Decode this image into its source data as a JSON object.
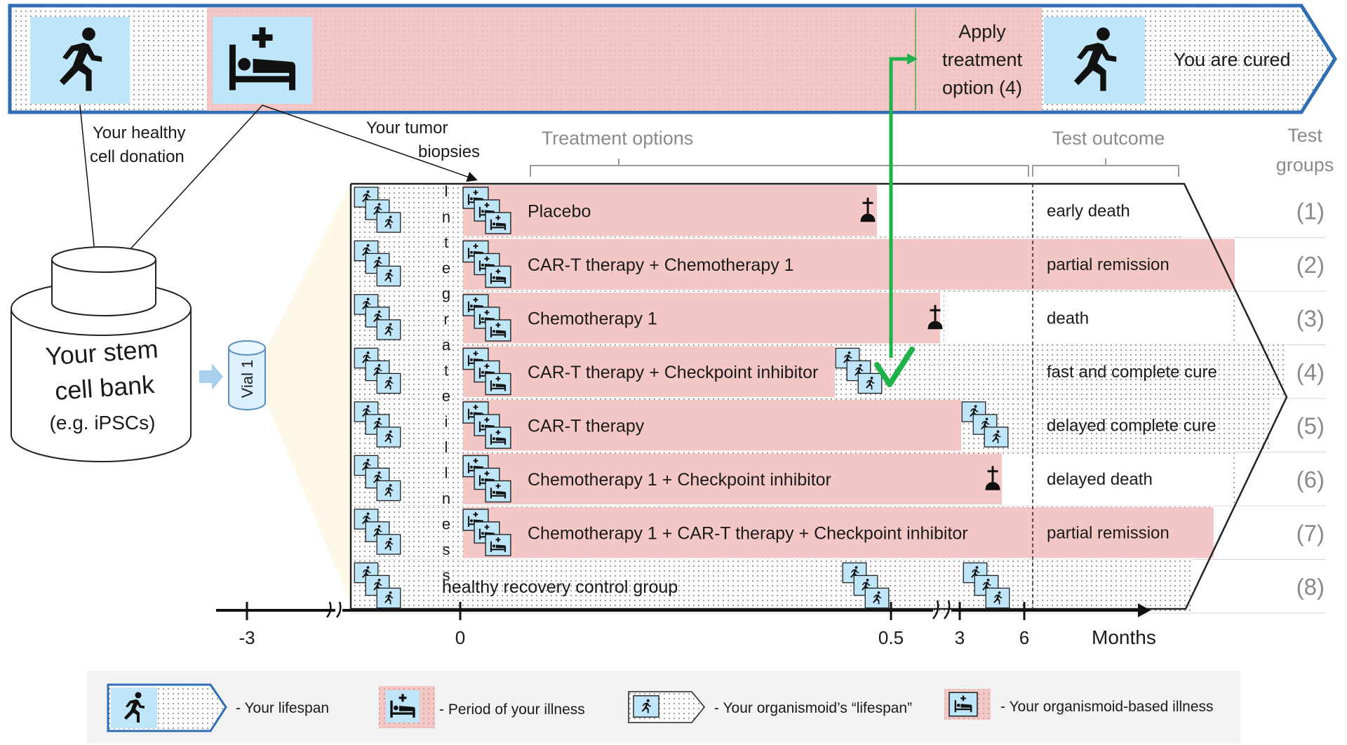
{
  "banner": {
    "apply_line1": "Apply",
    "apply_line2": "treatment",
    "apply_line3": "option (4)",
    "cured": "You are cured",
    "healthy_donation_line1": "Your healthy",
    "healthy_donation_line2": "cell donation",
    "tumor_biopsies_line1": "Your tumor",
    "tumor_biopsies_line2": "biopsies"
  },
  "stem_cell_bank": {
    "line1": "Your stem",
    "line2": "cell bank",
    "line3": "(e.g. iPSCs)",
    "vial": "Vial 1"
  },
  "headers": {
    "treatment_options": "Treatment options",
    "test_outcome": "Test outcome",
    "test_groups_line1": "Test",
    "test_groups_line2": "groups"
  },
  "integrate_letters": [
    "I",
    "n",
    "t",
    "e",
    "g",
    "r",
    "a",
    "t",
    "e"
  ],
  "illness_letters": [
    "i",
    "l",
    "l",
    "n",
    "e",
    "s",
    "s"
  ],
  "groups": [
    {
      "treatment": "Placebo",
      "outcome": "early death",
      "group": "(1)",
      "end_icon": "grave-icon"
    },
    {
      "treatment": "CAR-T therapy + Chemotherapy 1",
      "outcome": "partial remission",
      "group": "(2)",
      "end_icon": ""
    },
    {
      "treatment": "Chemotherapy 1",
      "outcome": "death",
      "group": "(3)",
      "end_icon": "grave-icon"
    },
    {
      "treatment": "CAR-T therapy + Checkpoint inhibitor",
      "outcome": "fast and complete cure",
      "group": "(4)",
      "end_icon": "runner-icon"
    },
    {
      "treatment": "CAR-T therapy",
      "outcome": "delayed complete cure",
      "group": "(5)",
      "end_icon": "runner-icon"
    },
    {
      "treatment": "Chemotherapy 1 + Checkpoint inhibitor",
      "outcome": "delayed death",
      "group": "(6)",
      "end_icon": "grave-icon"
    },
    {
      "treatment": "Chemotherapy 1 + CAR-T therapy + Checkpoint inhibitor",
      "outcome": "partial remission",
      "group": "(7)",
      "end_icon": ""
    },
    {
      "treatment": "healthy recovery control group",
      "outcome": "",
      "group": "(8)",
      "end_icon": "runner-icon"
    }
  ],
  "axis": {
    "ticks": [
      "-3",
      "0",
      "0.5",
      "3",
      "6"
    ],
    "unit": "Months"
  },
  "legend": {
    "lifespan": "- Your lifespan",
    "illness": "- Period of your illness",
    "organismoid_lifespan": "- Your organismoid’s “lifespan”",
    "organismoid_illness": "- Your organismoid-based illness"
  },
  "colors": {
    "illness_pink": "#f4c7c7",
    "icon_blue": "#bfe6f8",
    "banner_border": "#2f6db5",
    "check_green": "#1fb14a"
  }
}
